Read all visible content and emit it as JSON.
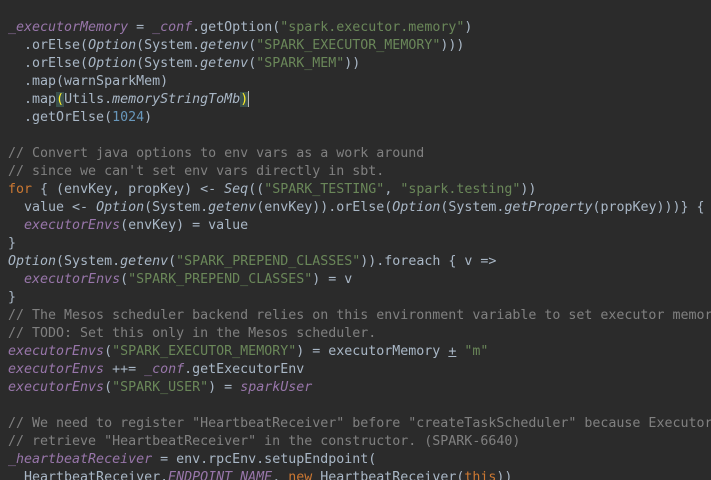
{
  "editor": {
    "lines": [
      [
        {
          "t": "_executorMemory",
          "c": "field"
        },
        {
          "t": " = "
        },
        {
          "t": "_conf",
          "c": "field"
        },
        {
          "t": ".getOption("
        },
        {
          "t": "\"spark.executor.memory\"",
          "c": "str"
        },
        {
          "t": ")"
        }
      ],
      [
        {
          "t": "  .orElse("
        },
        {
          "t": "Option",
          "c": "fn"
        },
        {
          "t": "(System."
        },
        {
          "t": "getenv",
          "c": "fn"
        },
        {
          "t": "("
        },
        {
          "t": "\"SPARK_EXECUTOR_MEMORY\"",
          "c": "str"
        },
        {
          "t": ")))"
        }
      ],
      [
        {
          "t": "  .orElse("
        },
        {
          "t": "Option",
          "c": "fn"
        },
        {
          "t": "(System."
        },
        {
          "t": "getenv",
          "c": "fn"
        },
        {
          "t": "("
        },
        {
          "t": "\"SPARK_MEM\"",
          "c": "str"
        },
        {
          "t": "))"
        }
      ],
      [
        {
          "t": "  .map(warnSparkMem)"
        }
      ],
      [
        {
          "t": "  .map"
        },
        {
          "t": "(",
          "c": "bracket"
        },
        {
          "t": "Utils."
        },
        {
          "t": "memoryStringToMb",
          "c": "fn"
        },
        {
          "t": ")",
          "c": "bracket"
        },
        {
          "t": "",
          "c": "caret"
        }
      ],
      [
        {
          "t": "  .getOrElse("
        },
        {
          "t": "1024",
          "c": "num"
        },
        {
          "t": ")"
        }
      ],
      [],
      [
        {
          "t": "// Convert java options to env vars as a work around",
          "c": "cmt"
        }
      ],
      [
        {
          "t": "// since we can't set env vars directly in sbt.",
          "c": "cmt"
        }
      ],
      [
        {
          "t": "for",
          "c": "kw"
        },
        {
          "t": " { (envKey, propKey) <- "
        },
        {
          "t": "Seq",
          "c": "fn"
        },
        {
          "t": "(("
        },
        {
          "t": "\"SPARK_TESTING\"",
          "c": "str"
        },
        {
          "t": ", "
        },
        {
          "t": "\"spark.testing\"",
          "c": "str"
        },
        {
          "t": "))"
        }
      ],
      [
        {
          "t": "  value <- "
        },
        {
          "t": "Option",
          "c": "fn"
        },
        {
          "t": "(System."
        },
        {
          "t": "getenv",
          "c": "fn"
        },
        {
          "t": "(envKey)).orElse("
        },
        {
          "t": "Option",
          "c": "fn"
        },
        {
          "t": "(System."
        },
        {
          "t": "getProperty",
          "c": "fn"
        },
        {
          "t": "(propKey)))} {"
        }
      ],
      [
        {
          "t": "  "
        },
        {
          "t": "executorEnvs",
          "c": "field"
        },
        {
          "t": "(envKey) = value"
        }
      ],
      [
        {
          "t": "}"
        }
      ],
      [
        {
          "t": "Option",
          "c": "fn"
        },
        {
          "t": "(System."
        },
        {
          "t": "getenv",
          "c": "fn"
        },
        {
          "t": "("
        },
        {
          "t": "\"SPARK_PREPEND_CLASSES\"",
          "c": "str"
        },
        {
          "t": ")).foreach { v =>"
        }
      ],
      [
        {
          "t": "  "
        },
        {
          "t": "executorEnvs",
          "c": "field"
        },
        {
          "t": "("
        },
        {
          "t": "\"SPARK_PREPEND_CLASSES\"",
          "c": "str"
        },
        {
          "t": ") = v"
        }
      ],
      [
        {
          "t": "}"
        }
      ],
      [
        {
          "t": "// The Mesos scheduler backend relies on this environment variable to set executor memor",
          "c": "cmt"
        }
      ],
      [
        {
          "t": "// TODO: Set this only in the Mesos scheduler.",
          "c": "cmt"
        }
      ],
      [
        {
          "t": "executorEnvs",
          "c": "field"
        },
        {
          "t": "("
        },
        {
          "t": "\"SPARK_EXECUTOR_MEMORY\"",
          "c": "str"
        },
        {
          "t": ") = executorMemory "
        },
        {
          "t": "+",
          "c": "underline"
        },
        {
          "t": " "
        },
        {
          "t": "\"m\"",
          "c": "str"
        }
      ],
      [
        {
          "t": "executorEnvs",
          "c": "field"
        },
        {
          "t": " ++= "
        },
        {
          "t": "_conf",
          "c": "field"
        },
        {
          "t": ".getExecutorEnv"
        }
      ],
      [
        {
          "t": "executorEnvs",
          "c": "field"
        },
        {
          "t": "("
        },
        {
          "t": "\"SPARK_USER\"",
          "c": "str"
        },
        {
          "t": ") = "
        },
        {
          "t": "sparkUser",
          "c": "field"
        }
      ],
      [],
      [
        {
          "t": "// We need to register \"HeartbeatReceiver\" before \"createTaskScheduler\" because Executor",
          "c": "cmt"
        }
      ],
      [
        {
          "t": "// retrieve \"HeartbeatReceiver\" in the constructor. (SPARK-6640)",
          "c": "cmt"
        }
      ],
      [
        {
          "t": "_heartbeatReceiver",
          "c": "field"
        },
        {
          "t": " = env.rpcEnv.setupEndpoint("
        }
      ],
      [
        {
          "t": "  HeartbeatReceiver."
        },
        {
          "t": "ENDPOINT_NAME",
          "c": "field"
        },
        {
          "t": ", "
        },
        {
          "t": "new",
          "c": "kw"
        },
        {
          "t": " HeartbeatReceiver("
        },
        {
          "t": "this",
          "c": "kw"
        },
        {
          "t": "))"
        }
      ]
    ]
  }
}
